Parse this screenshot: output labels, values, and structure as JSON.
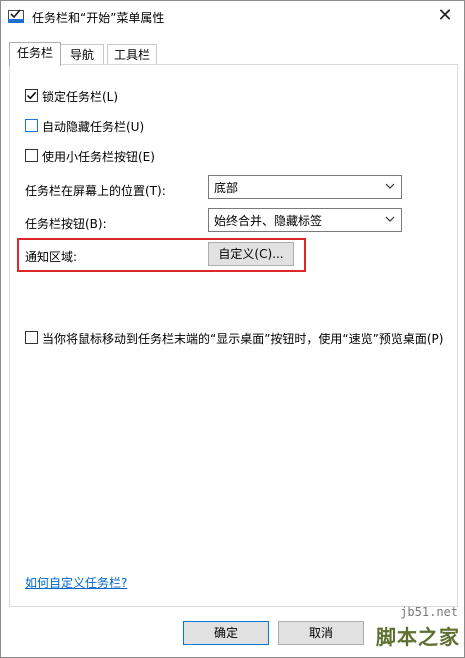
{
  "window": {
    "title": "任务栏和“开始”菜单属性",
    "close_glyph": "✕"
  },
  "tabs": [
    {
      "label": "任务栏",
      "active": true
    },
    {
      "label": "导航",
      "active": false
    },
    {
      "label": "工具栏",
      "active": false
    }
  ],
  "taskbar": {
    "lock_taskbar": {
      "label": "锁定任务栏(L)",
      "checked": true
    },
    "auto_hide": {
      "label": "自动隐藏任务栏(U)",
      "checked": false
    },
    "small_buttons": {
      "label": "使用小任务栏按钮(E)",
      "checked": false
    },
    "location": {
      "label": "任务栏在屏幕上的位置(T):",
      "value": "底部"
    },
    "buttons": {
      "label": "任务栏按钮(B):",
      "value": "始终合并、隐藏标签"
    },
    "notification_area": {
      "label": "通知区域:",
      "customize_label": "自定义(C)..."
    },
    "peek": {
      "label": "当你将鼠标移动到任务栏末端的“显示桌面”按钮时，使用“速览”预览桌面(P)",
      "checked": false
    },
    "help_link": "如何自定义任务栏?"
  },
  "footer": {
    "ok_label": "确定",
    "cancel_label": "取消"
  },
  "watermark": {
    "url": "jb51.net",
    "text": "脚本之家"
  },
  "colors": {
    "highlight_box": "#e02727",
    "link": "#0066cc",
    "default_button_border": "#0078d7"
  }
}
